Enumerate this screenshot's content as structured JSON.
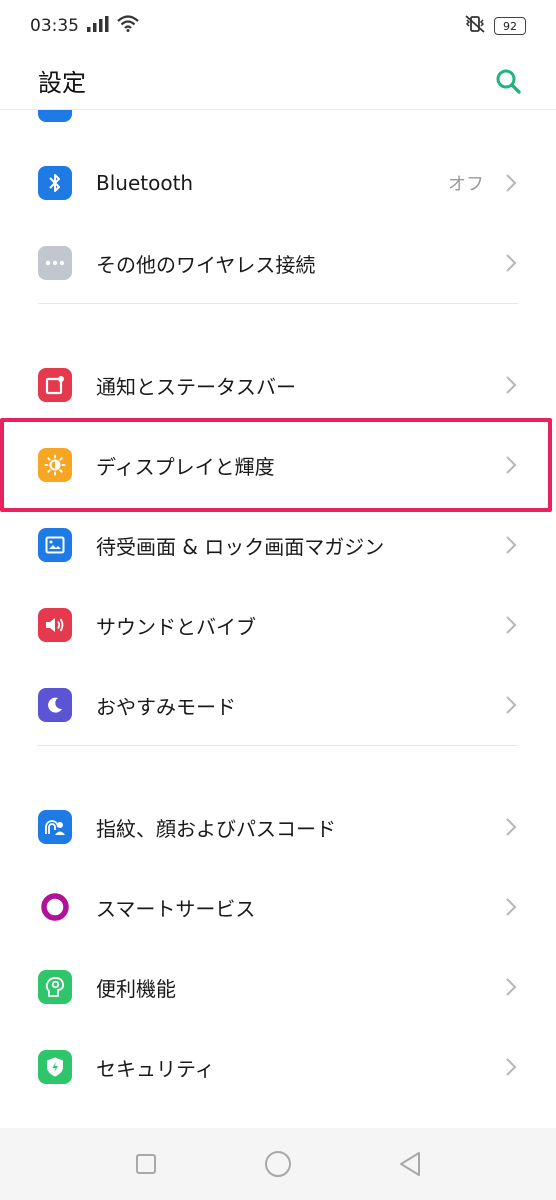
{
  "status_bar": {
    "time": "03:35",
    "battery": "92",
    "icons": [
      "signal-icon",
      "wifi-icon",
      "vibrate-icon",
      "battery-icon"
    ]
  },
  "header": {
    "title": "設定",
    "search_icon": "search-icon",
    "accent_color": "#1fb67d"
  },
  "sections": [
    {
      "items": [
        {
          "label": "Bluetooth",
          "value": "オフ",
          "icon": "bluetooth-icon",
          "color": "#1e7be6"
        },
        {
          "label": "その他のワイヤレス接続",
          "value": "",
          "icon": "more-connections-icon",
          "color": "#c2c6cf"
        }
      ]
    },
    {
      "items": [
        {
          "label": "通知とステータスバー",
          "value": "",
          "icon": "notification-icon",
          "color": "#e5394d"
        },
        {
          "label": "ディスプレイと輝度",
          "value": "",
          "icon": "brightness-icon",
          "color": "#f6a623",
          "highlighted": true
        },
        {
          "label": "待受画面 & ロック画面マガジン",
          "value": "",
          "icon": "wallpaper-icon",
          "color": "#1e7be6"
        },
        {
          "label": "サウンドとバイブ",
          "value": "",
          "icon": "sound-icon",
          "color": "#e5394d"
        },
        {
          "label": "おやすみモード",
          "value": "",
          "icon": "moon-icon",
          "color": "#5b55d6"
        }
      ]
    },
    {
      "items": [
        {
          "label": "指紋、顔およびパスコード",
          "value": "",
          "icon": "fingerprint-face-icon",
          "color": "#1e7be6"
        },
        {
          "label": "スマートサービス",
          "value": "",
          "icon": "smart-service-icon",
          "color": "#ffffff"
        },
        {
          "label": "便利機能",
          "value": "",
          "icon": "convenience-icon",
          "color": "#2fc56b"
        },
        {
          "label": "セキュリティ",
          "value": "",
          "icon": "security-shield-icon",
          "color": "#2fc56b"
        }
      ]
    }
  ],
  "highlight_color": "#e8215f",
  "nav_bar": {
    "icons": [
      "recent-apps-icon",
      "home-icon",
      "back-icon"
    ]
  }
}
